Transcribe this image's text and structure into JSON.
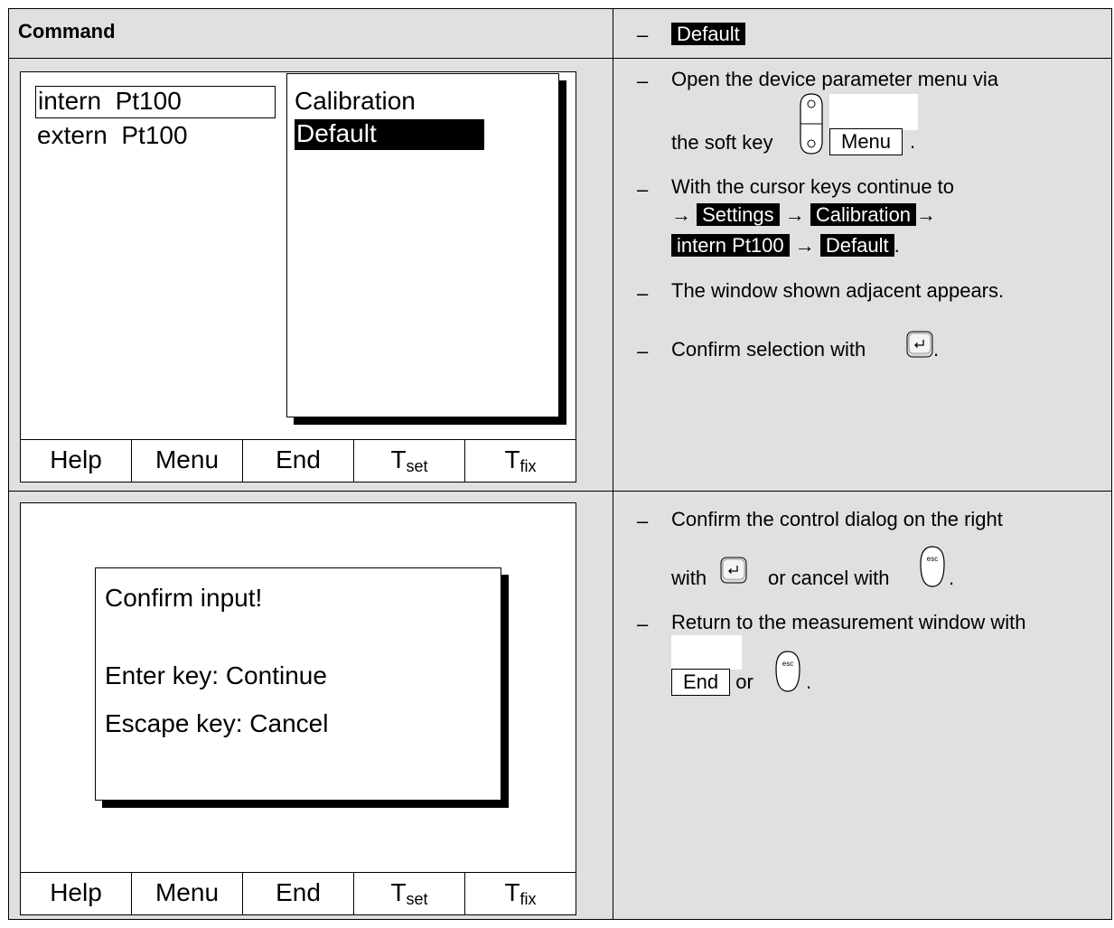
{
  "header": {
    "command": "Command",
    "default_label": "Default"
  },
  "screen1": {
    "left_items": [
      "intern  Pt100",
      "extern  Pt100"
    ],
    "popup_items": [
      "Calibration",
      "Default"
    ],
    "softkeys": {
      "help": "Help",
      "menu": "Menu",
      "end": "End",
      "tset": "T",
      "tset_sub": "set",
      "tfix": "T",
      "tfix_sub": "fix"
    }
  },
  "screen2": {
    "dialog_title": "Confirm input!",
    "enter_line": "Enter key: Continue",
    "escape_line": "Escape key: Cancel",
    "softkeys": {
      "help": "Help",
      "menu": "Menu",
      "end": "End",
      "tset": "T",
      "tset_sub": "set",
      "tfix": "T",
      "tfix_sub": "fix"
    }
  },
  "instructions": {
    "dash": "–",
    "step1_line1": "Open the device parameter menu via",
    "step1_line2_prefix": "the soft key",
    "step1_key": "Menu",
    "step1_suffix": ".",
    "step2_line1": "With the cursor keys continue to",
    "arrow": "→",
    "path_settings": "Settings",
    "path_calibration": "Calibration",
    "path_intern": "intern Pt100",
    "path_default": "Default",
    "period": ".",
    "step3": "The window shown adjacent appears.",
    "step4_prefix": "Confirm selection with",
    "step4_suffix": ".",
    "step5_line1": "Confirm the control dialog on the right",
    "step5_with": "with",
    "step5_or_cancel": "or cancel with",
    "step5_suffix": ".",
    "step6_line1": "Return to the measurement window with",
    "step6_key": "End",
    "step6_or": "or",
    "step6_suffix": "."
  },
  "icons": [
    "enter-key-icon",
    "esc-key-icon",
    "soft-key-icon"
  ]
}
